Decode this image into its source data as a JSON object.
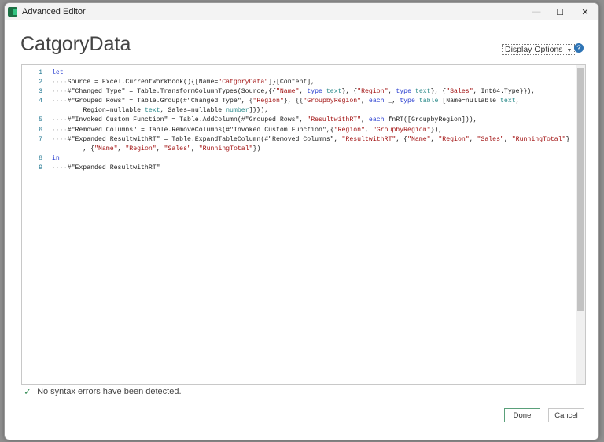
{
  "window": {
    "title": "Advanced Editor",
    "minimize": "—",
    "maximize": "☐",
    "close": "✕"
  },
  "heading": "CatgoryData",
  "display_options": {
    "label": "Display Options",
    "caret": "▼"
  },
  "help": "?",
  "code_lines": [
    {
      "num": "1",
      "indent": 0,
      "tokens": [
        [
          "k",
          "let"
        ]
      ]
    },
    {
      "num": "2",
      "indent": 4,
      "tokens": [
        [
          "p",
          "Source = Excel.CurrentWorkbook(){[Name="
        ],
        [
          "s",
          "\"CatgoryData\""
        ],
        [
          "p",
          "]}[Content],"
        ]
      ]
    },
    {
      "num": "3",
      "indent": 4,
      "tokens": [
        [
          "p",
          "#\"Changed Type\" = Table.TransformColumnTypes(Source,{{"
        ],
        [
          "s",
          "\"Name\""
        ],
        [
          "p",
          ", "
        ],
        [
          "k",
          "type"
        ],
        [
          "p",
          " "
        ],
        [
          "t",
          "text"
        ],
        [
          "p",
          "}, {"
        ],
        [
          "s",
          "\"Region\""
        ],
        [
          "p",
          ", "
        ],
        [
          "k",
          "type"
        ],
        [
          "p",
          " "
        ],
        [
          "t",
          "text"
        ],
        [
          "p",
          "}, {"
        ],
        [
          "s",
          "\"Sales\""
        ],
        [
          "p",
          ", Int64.Type}}),"
        ]
      ]
    },
    {
      "num": "4",
      "indent": 4,
      "tokens": [
        [
          "p",
          "#\"Grouped Rows\" = Table.Group(#\"Changed Type\", {"
        ],
        [
          "s",
          "\"Region\""
        ],
        [
          "p",
          "}, {{"
        ],
        [
          "s",
          "\"GroupbyRegion\""
        ],
        [
          "p",
          ", "
        ],
        [
          "k",
          "each"
        ],
        [
          "p",
          " _, "
        ],
        [
          "k",
          "type"
        ],
        [
          "p",
          " "
        ],
        [
          "t",
          "table"
        ],
        [
          "p",
          " [Name=nullable "
        ],
        [
          "t",
          "text"
        ],
        [
          "p",
          ","
        ]
      ]
    },
    {
      "num": "",
      "indent": 0,
      "pad": "        ",
      "tokens": [
        [
          "p",
          "Region=nullable "
        ],
        [
          "t",
          "text"
        ],
        [
          "p",
          ", Sales=nullable "
        ],
        [
          "t",
          "number"
        ],
        [
          "p",
          "]}}),"
        ]
      ]
    },
    {
      "num": "5",
      "indent": 4,
      "tokens": [
        [
          "p",
          "#\"Invoked Custom Function\" = Table.AddColumn(#\"Grouped Rows\", "
        ],
        [
          "s",
          "\"ResultwithRT\""
        ],
        [
          "p",
          ", "
        ],
        [
          "k",
          "each"
        ],
        [
          "p",
          " fnRT([GroupbyRegion])),"
        ]
      ]
    },
    {
      "num": "6",
      "indent": 4,
      "tokens": [
        [
          "p",
          "#\"Removed Columns\" = Table.RemoveColumns(#\"Invoked Custom Function\",{"
        ],
        [
          "s",
          "\"Region\""
        ],
        [
          "p",
          ", "
        ],
        [
          "s",
          "\"GroupbyRegion\""
        ],
        [
          "p",
          "}),"
        ]
      ]
    },
    {
      "num": "7",
      "indent": 4,
      "tokens": [
        [
          "p",
          "#\"Expanded ResultwithRT\" = Table.ExpandTableColumn(#\"Removed Columns\", "
        ],
        [
          "s",
          "\"ResultwithRT\""
        ],
        [
          "p",
          ", {"
        ],
        [
          "s",
          "\"Name\""
        ],
        [
          "p",
          ", "
        ],
        [
          "s",
          "\"Region\""
        ],
        [
          "p",
          ", "
        ],
        [
          "s",
          "\"Sales\""
        ],
        [
          "p",
          ", "
        ],
        [
          "s",
          "\"RunningTotal\""
        ],
        [
          "p",
          "}"
        ]
      ]
    },
    {
      "num": "",
      "indent": 0,
      "pad": "        ",
      "tokens": [
        [
          "p",
          ", {"
        ],
        [
          "s",
          "\"Name\""
        ],
        [
          "p",
          ", "
        ],
        [
          "s",
          "\"Region\""
        ],
        [
          "p",
          ", "
        ],
        [
          "s",
          "\"Sales\""
        ],
        [
          "p",
          ", "
        ],
        [
          "s",
          "\"RunningTotal\""
        ],
        [
          "p",
          "})"
        ]
      ]
    },
    {
      "num": "8",
      "indent": 0,
      "tokens": [
        [
          "k",
          "in"
        ]
      ]
    },
    {
      "num": "9",
      "indent": 4,
      "tokens": [
        [
          "p",
          "#\"Expanded ResultwithRT\""
        ]
      ]
    }
  ],
  "status": {
    "icon": "check-icon",
    "message": "No syntax errors have been detected.",
    "check": "✓"
  },
  "buttons": {
    "done": "Done",
    "cancel": "Cancel"
  }
}
